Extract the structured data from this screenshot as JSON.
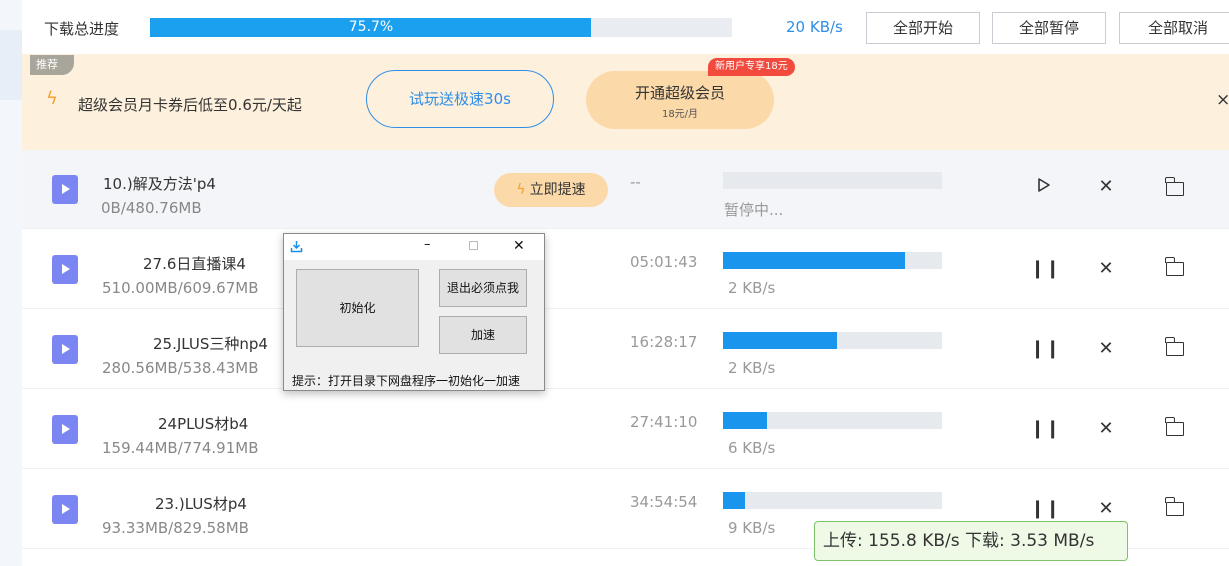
{
  "header": {
    "total_label": "下载总进度",
    "total_progress": 0.757,
    "total_percent_text": "75.7%",
    "speed": "20 KB/s",
    "start_all": "全部开始",
    "pause_all": "全部暂停",
    "cancel_all": "全部取消"
  },
  "promo": {
    "tag": "推荐",
    "text": "超级会员月卡券后低至0.6元/天起",
    "trial_button": "试玩送极速30s",
    "vip_button": "开通超级会员",
    "vip_price": "18元/月",
    "new_user_badge": "新用户专享18元",
    "close": "×"
  },
  "boost_button": "立即提速",
  "rows": [
    {
      "name": "10.)解及方法'p4",
      "size": "0B/480.76MB",
      "time": "--",
      "status": "暂停中...",
      "progress": 0.0,
      "paused": true
    },
    {
      "name": "27.6日直播课4",
      "size": "510.00MB/609.67MB",
      "time": "05:01:43",
      "status": "2 KB/s",
      "progress": 0.83,
      "paused": false
    },
    {
      "name": "25.JLUS三种np4",
      "size": "280.56MB/538.43MB",
      "time": "16:28:17",
      "status": "2 KB/s",
      "progress": 0.52,
      "paused": false
    },
    {
      "name": "24PLUS材b4",
      "size": "159.44MB/774.91MB",
      "time": "27:41:10",
      "status": "6 KB/s",
      "progress": 0.2,
      "paused": false
    },
    {
      "name": "23.)LUS材p4",
      "size": "93.33MB/829.58MB",
      "time": "34:54:54",
      "status": "9 KB/s",
      "progress": 0.1,
      "paused": false
    }
  ],
  "dialog": {
    "init_button": "初始化",
    "exit_button": "退出必须点我",
    "accelerate_button": "加速",
    "hint": "提示：打开目录下网盘程序一初始化一加速"
  },
  "speed_overlay": {
    "text": "上传: 155.8 KB/s 下载: 3.53 MB/s"
  }
}
